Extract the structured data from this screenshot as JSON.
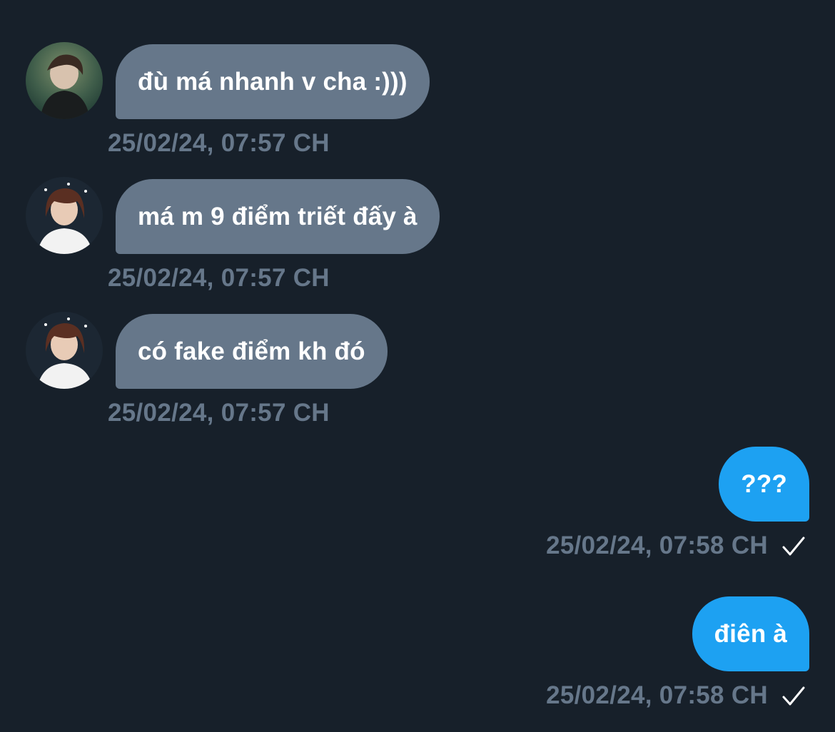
{
  "messages": [
    {
      "direction": "incoming",
      "text": "đù má nhanh v cha :)))",
      "timestamp": "25/02/24, 07:57 CH",
      "avatar_icon": "user-avatar-icon-green-photo"
    },
    {
      "direction": "incoming",
      "text": "má m 9 điểm triết đấy à",
      "timestamp": "25/02/24, 07:57 CH",
      "avatar_icon": "user-avatar-icon-portrait"
    },
    {
      "direction": "incoming",
      "text": "có fake điểm kh đó",
      "timestamp": "25/02/24, 07:57 CH",
      "avatar_icon": "user-avatar-icon-portrait"
    },
    {
      "direction": "outgoing",
      "text": "???",
      "timestamp": "25/02/24, 07:58 CH",
      "status_icon": "check-icon"
    },
    {
      "direction": "outgoing",
      "text": "điên à",
      "timestamp": "25/02/24, 07:58 CH",
      "status_icon": "check-icon"
    }
  ],
  "colors": {
    "background": "#17202a",
    "incoming_bubble": "#66778a",
    "outgoing_bubble": "#1da1f2",
    "timestamp": "#66778a",
    "text": "#ffffff"
  }
}
